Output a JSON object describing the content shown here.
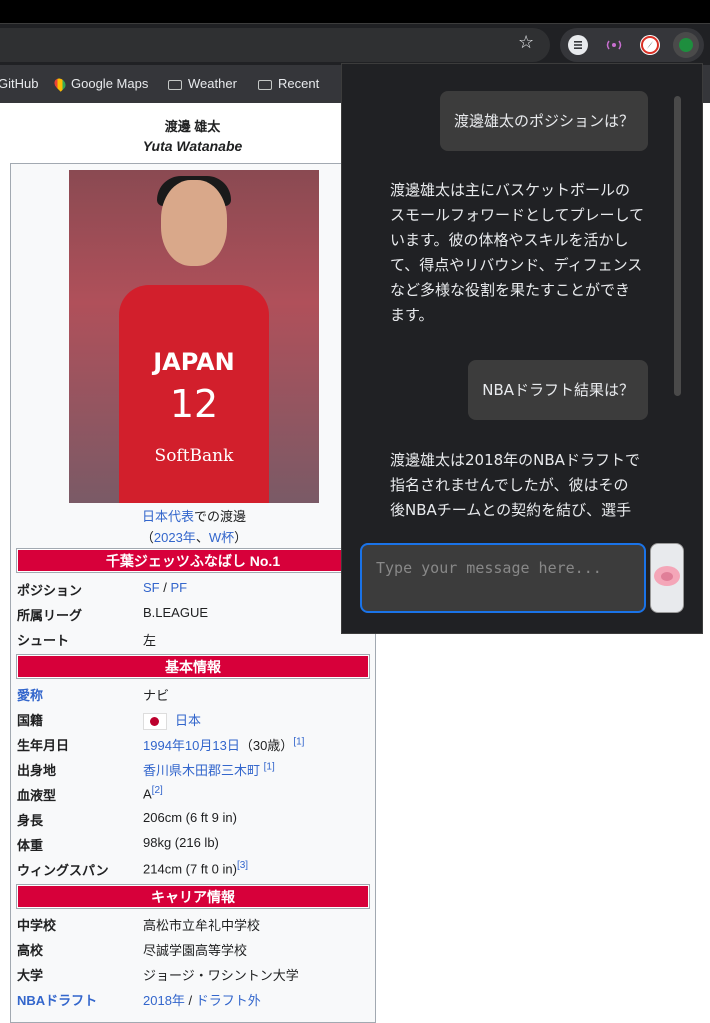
{
  "browser": {
    "bookmarks": [
      {
        "label": "GitHub",
        "icon": "none"
      },
      {
        "label": "Google Maps",
        "icon": "maps-pin-icon"
      },
      {
        "label": "Weather",
        "icon": "folder-icon"
      },
      {
        "label": "Recent",
        "icon": "folder-icon"
      }
    ]
  },
  "article": {
    "title_ja": "渡邊 雄太",
    "title_en": "Yuta Watanabe",
    "jersey_text": "JAPAN",
    "jersey_number": "12",
    "jersey_sponsor": "SoftBank",
    "caption_link1": "日本代表",
    "caption_text1": "での渡邊",
    "caption_open": "（",
    "caption_link2": "2023年",
    "caption_sep": "、",
    "caption_link3": "W杯",
    "caption_close": "）",
    "section_team": "千葉ジェッツふなばし  No.1",
    "section_basic": "基本情報",
    "section_career": "キャリア情報",
    "team_rows": [
      {
        "key": "ポジション",
        "v1": "SF",
        "sep": " / ",
        "v2": "PF"
      },
      {
        "key": "所属リーグ",
        "v1": "B.LEAGUE"
      },
      {
        "key": "シュート",
        "v1": "左"
      }
    ],
    "basic_rows": {
      "nickname_key": "愛称",
      "nickname_val": "ナビ",
      "nationality_key": "国籍",
      "nationality_val": "日本",
      "birth_key": "生年月日",
      "birth_val": "1994年10月13日",
      "birth_age": "（30歳）",
      "birth_ref": "[1]",
      "birthplace_key": "出身地",
      "birthplace_val": "香川県木田郡三木町",
      "birthplace_ref": "[1]",
      "blood_key": "血液型",
      "blood_val": "A",
      "blood_ref": "[2]",
      "height_key": "身長",
      "height_val": "206cm (6 ft 9 in)",
      "weight_key": "体重",
      "weight_val": "98kg (216 lb)",
      "wing_key": "ウィングスパン",
      "wing_val": "214cm  (7 ft 0 in)",
      "wing_ref": "[3]"
    },
    "career_rows": {
      "jhs_key": "中学校",
      "jhs_val": "高松市立牟礼中学校",
      "hs_key": "高校",
      "hs_val": "尽誠学園高等学校",
      "univ_key": "大学",
      "univ_val": "ジョージ・ワシントン大学",
      "draft_key": "NBAドラフト",
      "draft_year": "2018年",
      "draft_sep": " / ",
      "draft_val": "ドラフト外"
    }
  },
  "chat": {
    "messages": [
      {
        "role": "user",
        "text": "渡邊雄太のポジションは？"
      },
      {
        "role": "assistant",
        "lines": [
          "渡邊雄太は主にバスケットボールの",
          "スモールフォワードとしてプレーして",
          "います。彼の体格やスキルを活かし",
          "て、得点やリバウンド、ディフェンス",
          "など多様な役割を果たすことができ",
          "ます。"
        ]
      },
      {
        "role": "user",
        "text": "NBAドラフト結果は？"
      },
      {
        "role": "assistant",
        "lines": [
          "渡邊雄太は2018年のNBAドラフトで",
          "指名されませんでしたが、彼はその",
          "後NBAチームとの契約を結び、選手"
        ]
      }
    ],
    "input_placeholder": "Type your message here..."
  },
  "colors": {
    "infobox_header": "#d7003a",
    "link": "#3366cc",
    "chat_bg": "#202124",
    "input_focus": "#1a73e8"
  }
}
